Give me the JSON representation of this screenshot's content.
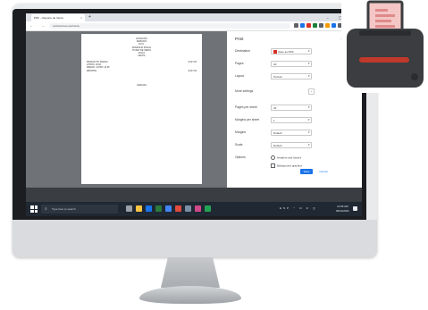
{
  "browser": {
    "tab_title": "PDF – Reporte de Venta",
    "tab_close": "×",
    "new_tab": "+",
    "window_controls": "– ▢ ×",
    "nav": "← → ⟳",
    "url": "cotizaciones.net/venta"
  },
  "document": {
    "header_lines": [
      "ESTACIÓN",
      "SERVICIO",
      "R.F.C.",
      "DOMICILIO FISCAL",
      "TICKET DE VENTA",
      "FOLIO",
      "FECHA"
    ],
    "left_lines": [
      "PRODUCTO: MAGNA",
      "LITROS: 20.00",
      "PRECIO / LITRO: 22.35",
      "IMPORTE:"
    ],
    "right_lines": [
      "$ 447.00",
      "",
      "",
      "$ 447.00"
    ],
    "footer": "GRACIAS"
  },
  "print_panel": {
    "title": "Print",
    "page_count": "1 page",
    "rows": [
      {
        "label": "Destination",
        "value": "Save as PDF",
        "type": "select"
      },
      {
        "label": "Pages",
        "value": "All",
        "type": "select"
      },
      {
        "label": "Layout",
        "value": "Portrait",
        "type": "select"
      },
      {
        "label": "More settings",
        "value": "",
        "type": "expander"
      },
      {
        "label": "Pages per sheet",
        "value": "All",
        "type": "select"
      },
      {
        "label": "Margins per sheet",
        "value": "1",
        "type": "select"
      },
      {
        "label": "Margins",
        "value": "Default",
        "type": "select"
      },
      {
        "label": "Scale",
        "value": "Default",
        "type": "select"
      },
      {
        "label": "Options",
        "value": "Headers and footers",
        "type": "checkbox"
      }
    ],
    "extra_option": "Background graphics",
    "save_label": "Save",
    "cancel_label": "Cancel"
  },
  "taskbar": {
    "search_placeholder": "Type here to search",
    "search_icon": "⌕",
    "tray": "ESP   ⌃ ⊡ ⊙ ◫",
    "time": "11:56 AM",
    "date": "06/11/2021"
  },
  "icons": {
    "printer": "printer-icon",
    "pdf": "pdf-icon"
  },
  "colors": {
    "accent": "#1a73e8",
    "printer_body": "#3b3d40",
    "paper": "#f4c6c6",
    "slot": "#c0392b"
  }
}
